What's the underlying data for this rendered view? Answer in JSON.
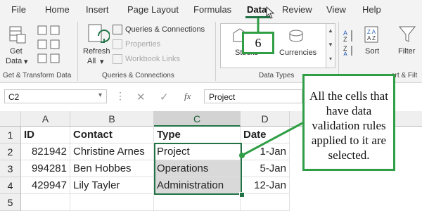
{
  "tabs": [
    "File",
    "Home",
    "Insert",
    "Page Layout",
    "Formulas",
    "Data",
    "Review",
    "View",
    "Help"
  ],
  "active_tab": "Data",
  "ribbon": {
    "get_data_label": "Get",
    "get_data_label2": "Data",
    "get_group": "Get & Transform Data",
    "refresh_label": "Refresh",
    "refresh_label2": "All",
    "queries_connections": "Queries & Connections",
    "properties": "Properties",
    "workbook_links": "Workbook Links",
    "queries_group": "Queries & Connections",
    "stocks": "Stocks",
    "currencies": "Currencies",
    "data_types_group": "Data Types",
    "sort": "Sort",
    "filter": "Filter",
    "sort_filter_group": "ort & Filt"
  },
  "badge": "6",
  "formula_bar": {
    "name_box": "C2",
    "fx": "fx",
    "value": "Project"
  },
  "columns": [
    "A",
    "B",
    "C",
    "D"
  ],
  "rows": [
    "1",
    "2",
    "3",
    "4",
    "5"
  ],
  "table": {
    "headers": [
      "ID",
      "Contact",
      "Type",
      "Date"
    ],
    "data": [
      [
        "821942",
        "Christine Arnes",
        "Project",
        "1-Jan"
      ],
      [
        "994281",
        "Ben Hobbes",
        "Operations",
        "5-Jan"
      ],
      [
        "429947",
        "Lily Tayler",
        "Administration",
        "12-Jan"
      ]
    ]
  },
  "callout": "All the cells that have data validation rules applied to it are selected."
}
